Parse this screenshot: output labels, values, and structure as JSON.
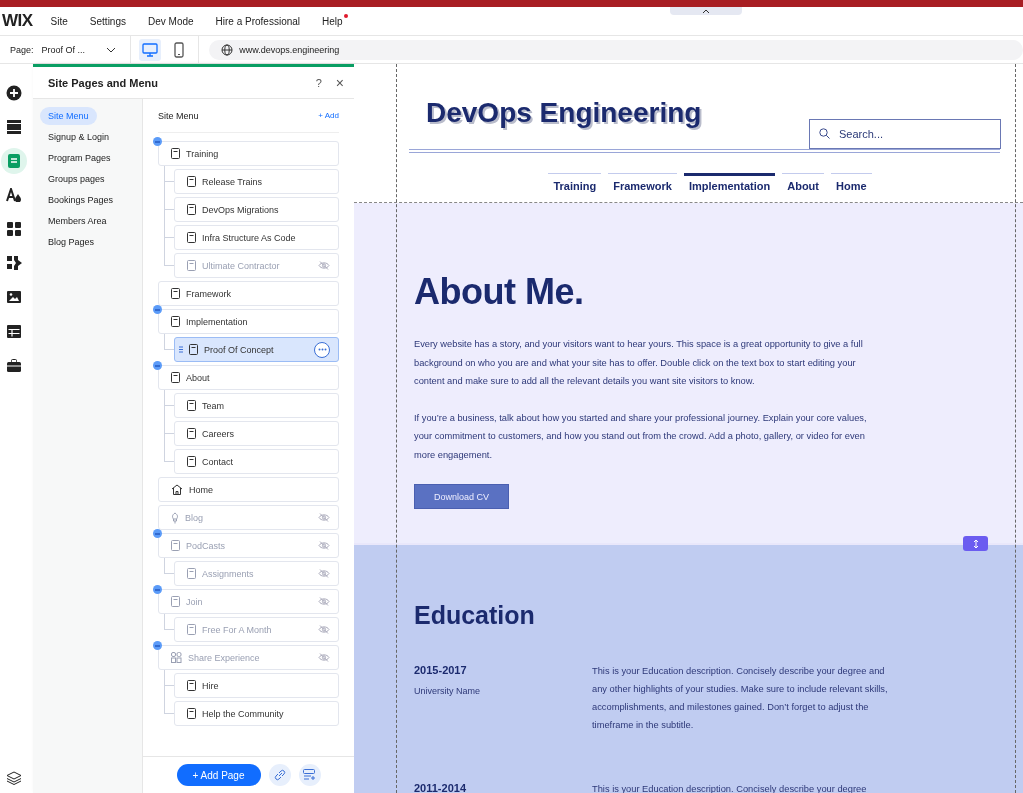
{
  "menu_bar": {
    "logo": "WIX",
    "items": [
      {
        "label": "Site"
      },
      {
        "label": "Settings"
      },
      {
        "label": "Dev Mode"
      },
      {
        "label": "Hire a Professional"
      },
      {
        "label": "Help",
        "badge": true
      }
    ]
  },
  "toolbar": {
    "page_label": "Page:",
    "page_value": "Proof Of ...",
    "views": [
      {
        "selected": true
      },
      {
        "selected": false
      }
    ],
    "url": "www.devops.engineering"
  },
  "rail": [
    {
      "selected": false
    },
    {
      "selected": false
    },
    {
      "selected": true
    },
    {
      "selected": false
    },
    {
      "selected": false
    },
    {
      "selected": false
    },
    {
      "selected": false
    },
    {
      "selected": false
    },
    {
      "selected": false
    },
    {
      "selected": false
    }
  ],
  "panel": {
    "title": "Site Pages and Menu",
    "help": "?",
    "close": "×",
    "categories": [
      {
        "label": "Site Menu",
        "selected": true
      },
      {
        "label": "Signup & Login",
        "selected": false
      },
      {
        "label": "Program Pages",
        "selected": false
      },
      {
        "label": "Groups pages",
        "selected": false
      },
      {
        "label": "Bookings Pages",
        "selected": false
      },
      {
        "label": "Members Area",
        "selected": false
      },
      {
        "label": "Blog Pages",
        "selected": false
      }
    ],
    "menu_title": "Site Menu",
    "add": "+ Add",
    "items": [
      {
        "label": "Training",
        "kind": "page",
        "hidden": false,
        "selected": false,
        "expanded": true,
        "children": [
          {
            "label": "Release Trains",
            "kind": "page",
            "hidden": false,
            "selected": false
          },
          {
            "label": "DevOps Migrations",
            "kind": "page",
            "hidden": false,
            "selected": false
          },
          {
            "label": "Infra Structure As Code",
            "kind": "page",
            "hidden": false,
            "selected": false
          },
          {
            "label": "Ultimate Contractor",
            "kind": "page",
            "hidden": true,
            "selected": false
          }
        ]
      },
      {
        "label": "Framework",
        "kind": "page",
        "hidden": false,
        "selected": false
      },
      {
        "label": "Implementation",
        "kind": "page",
        "hidden": false,
        "selected": false,
        "expanded": true,
        "children": [
          {
            "label": "Proof Of Concept",
            "kind": "page",
            "hidden": false,
            "selected": true
          }
        ]
      },
      {
        "label": "About",
        "kind": "page",
        "hidden": false,
        "selected": false,
        "expanded": true,
        "children": [
          {
            "label": "Team",
            "kind": "page",
            "hidden": false,
            "selected": false
          },
          {
            "label": "Careers",
            "kind": "page",
            "hidden": false,
            "selected": false
          },
          {
            "label": "Contact",
            "kind": "page",
            "hidden": false,
            "selected": false
          }
        ]
      },
      {
        "label": "Home",
        "kind": "home",
        "hidden": false,
        "selected": false
      },
      {
        "label": "Blog",
        "kind": "blog",
        "hidden": true,
        "selected": false
      },
      {
        "label": "PodCasts",
        "kind": "page",
        "hidden": true,
        "selected": false,
        "expanded": true,
        "children": [
          {
            "label": "Assignments",
            "kind": "page",
            "hidden": true,
            "selected": false
          }
        ]
      },
      {
        "label": "Join",
        "kind": "page",
        "hidden": true,
        "selected": false,
        "expanded": true,
        "children": [
          {
            "label": "Free For A Month",
            "kind": "page",
            "hidden": true,
            "selected": false
          }
        ]
      },
      {
        "label": "Share Experience",
        "kind": "members",
        "hidden": true,
        "selected": false,
        "expanded": true,
        "children": [
          {
            "label": "Hire",
            "kind": "page",
            "hidden": false,
            "selected": false
          },
          {
            "label": "Help the Community",
            "kind": "page",
            "hidden": false,
            "selected": false
          }
        ]
      }
    ],
    "add_page": "+ Add Page"
  },
  "site": {
    "title": "DevOps Engineering",
    "search_placeholder": "Search...",
    "nav": [
      {
        "label": "Training",
        "selected": false
      },
      {
        "label": "Framework",
        "selected": false
      },
      {
        "label": "Implementation",
        "selected": true
      },
      {
        "label": "About",
        "selected": false
      },
      {
        "label": "Home",
        "selected": false
      }
    ],
    "about": {
      "heading": "About Me.",
      "paragraphs": [
        "Every website has a story, and your visitors want to hear yours. This space is a great opportunity to give a full background on who you are and what your site has to offer. Double click on the text box to start editing your content and make sure to add all the relevant details you want site visitors to know.",
        "If you’re a business, talk about how you started and share your professional journey. Explain your core values, your commitment to customers, and how you stand out from the crowd. Add a photo, gallery, or video for even more engagement."
      ],
      "button": "Download CV"
    },
    "education": {
      "heading": "Education",
      "rows": [
        {
          "years": "2015-2017",
          "school": "University Name",
          "description": "This is your Education description. Concisely describe your degree and any other highlights of your studies. Make sure to include relevant skills, accomplishments, and milestones gained. Don’t forget to adjust the timeframe in the subtitle."
        },
        {
          "years": "2011-2014",
          "description": "This is your Education description. Concisely describe your degree"
        }
      ]
    }
  }
}
